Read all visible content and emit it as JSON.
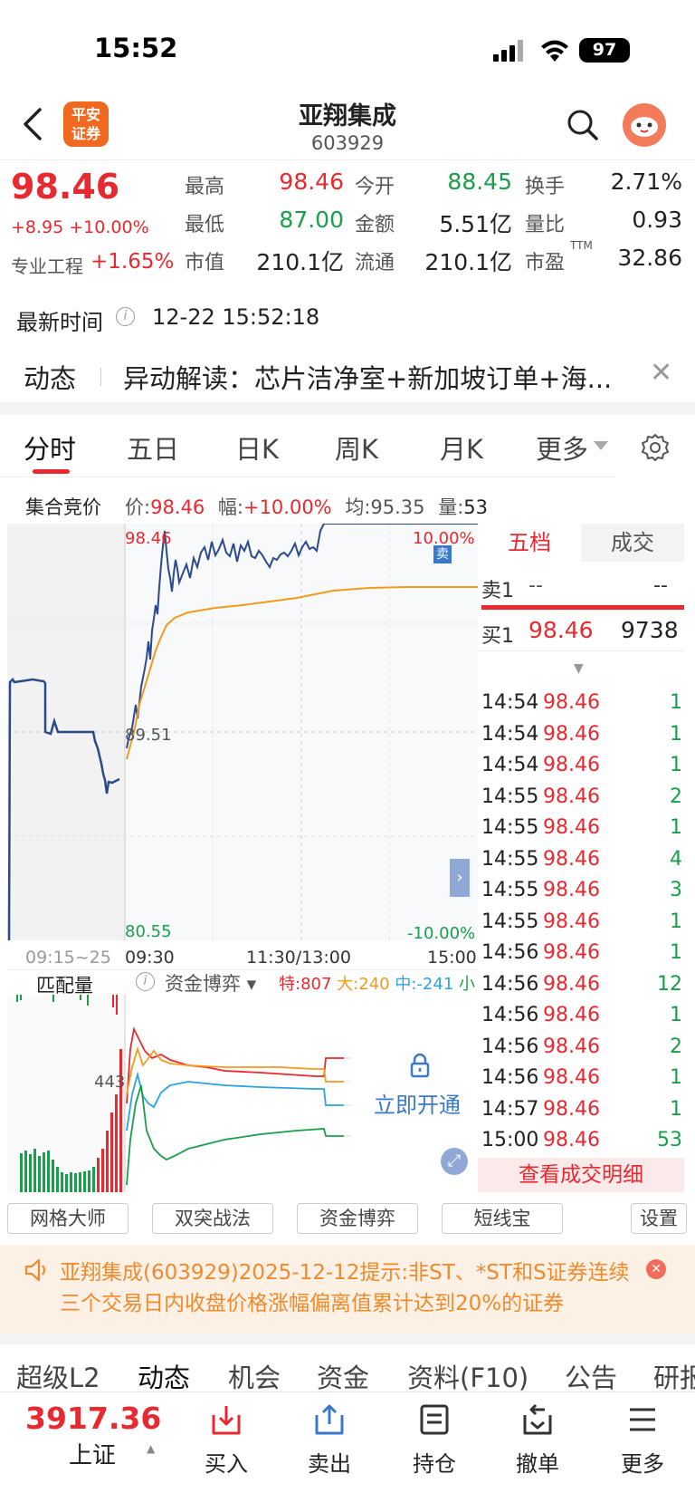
{
  "status_bar": {
    "time": "15:52",
    "battery": "97"
  },
  "nav": {
    "title": "亚翔集成",
    "code": "603929",
    "logo_line1": "平安",
    "logo_line2": "证券"
  },
  "quote": {
    "price": "98.46",
    "change": "+8.95 +10.00%",
    "sector_label": "专业工程",
    "sector_change": "+1.65%",
    "stats": [
      {
        "label": "最高",
        "value": "98.46",
        "color": "red"
      },
      {
        "label": "今开",
        "value": "88.45",
        "color": "green"
      },
      {
        "label": "换手",
        "value": "2.71%",
        "color": "black"
      },
      {
        "label": "最低",
        "value": "87.00",
        "color": "green"
      },
      {
        "label": "金额",
        "value": "5.51亿",
        "color": "black"
      },
      {
        "label": "量比",
        "value": "0.93",
        "color": "black"
      },
      {
        "label": "市值",
        "value": "210.1亿",
        "color": "black"
      },
      {
        "label": "流通",
        "value": "210.1亿",
        "color": "black"
      },
      {
        "label": "市盈",
        "value": "32.86",
        "color": "black",
        "sup": "TTM"
      }
    ],
    "update_label": "最新时间",
    "update_time": "12-22 15:52:18"
  },
  "news": {
    "tag": "动态",
    "text": "异动解读：芯片洁净室+新加坡订单+海..."
  },
  "tabs": [
    "分时",
    "五日",
    "日K",
    "周K",
    "月K",
    "更多"
  ],
  "auction": {
    "title": "集合竞价",
    "price_label": "价:",
    "price": "98.46",
    "amp_label": "幅:",
    "amp": "+10.00%",
    "avg_label": "均:",
    "avg": "95.35",
    "vol_label": "量:",
    "vol": "53"
  },
  "chart": {
    "top_price": "98.46",
    "mid_price": "89.51",
    "bottom_price": "80.55",
    "top_pct": "10.00%",
    "bottom_pct": "-10.00%",
    "sell_badge": "卖",
    "time_labels": [
      "09:15~25",
      "09:30",
      "11:30/13:00",
      "15:00"
    ]
  },
  "flow": {
    "match_label": "匹配量",
    "mode_label": "资金博弈",
    "special_label": "特:",
    "special": "807",
    "large_label": "大:",
    "large": "240",
    "medium_label": "中:",
    "medium": "-241",
    "small_label": "小",
    "vol_label": "443",
    "unlock_label": "立即开通"
  },
  "orderbook": {
    "tab_five": "五档",
    "tab_deals": "成交",
    "sell1_label": "卖1",
    "sell1_price": "--",
    "sell1_vol": "--",
    "buy1_label": "买1",
    "buy1_price": "98.46",
    "buy1_vol": "9738",
    "ticks": [
      {
        "time": "14:54",
        "price": "98.46",
        "vol": "1"
      },
      {
        "time": "14:54",
        "price": "98.46",
        "vol": "1"
      },
      {
        "time": "14:54",
        "price": "98.46",
        "vol": "1"
      },
      {
        "time": "14:55",
        "price": "98.46",
        "vol": "2"
      },
      {
        "time": "14:55",
        "price": "98.46",
        "vol": "1"
      },
      {
        "time": "14:55",
        "price": "98.46",
        "vol": "4"
      },
      {
        "time": "14:55",
        "price": "98.46",
        "vol": "3"
      },
      {
        "time": "14:55",
        "price": "98.46",
        "vol": "1"
      },
      {
        "time": "14:56",
        "price": "98.46",
        "vol": "1"
      },
      {
        "time": "14:56",
        "price": "98.46",
        "vol": "12"
      },
      {
        "time": "14:56",
        "price": "98.46",
        "vol": "1"
      },
      {
        "time": "14:56",
        "price": "98.46",
        "vol": "2"
      },
      {
        "time": "14:56",
        "price": "98.46",
        "vol": "1"
      },
      {
        "time": "14:57",
        "price": "98.46",
        "vol": "1"
      },
      {
        "time": "15:00",
        "price": "98.46",
        "vol": "53"
      }
    ],
    "detail_link": "查看成交明细"
  },
  "tools": [
    "网格大师",
    "双突战法",
    "资金博弈",
    "短线宝"
  ],
  "tools_settings": "设置",
  "notice": {
    "text": "亚翔集成(603929)2025-12-12提示:非ST、*ST和S证券连续三个交易日内收盘价格涨幅偏离值累计达到20%的证券"
  },
  "sub_tabs": [
    "超级L2",
    "动态",
    "机会",
    "资金",
    "资料(F10)",
    "公告",
    "研报"
  ],
  "footer": {
    "index_value": "3917.36",
    "index_name": "上证",
    "actions": [
      "买入",
      "卖出",
      "持仓",
      "撤单",
      "更多"
    ]
  },
  "colors": {
    "red": "#e8292f",
    "green": "#1a9e4b",
    "price_line": "#2b4a8c",
    "avg_line": "#f39a1e",
    "accent_blue": "#3a78c9"
  }
}
